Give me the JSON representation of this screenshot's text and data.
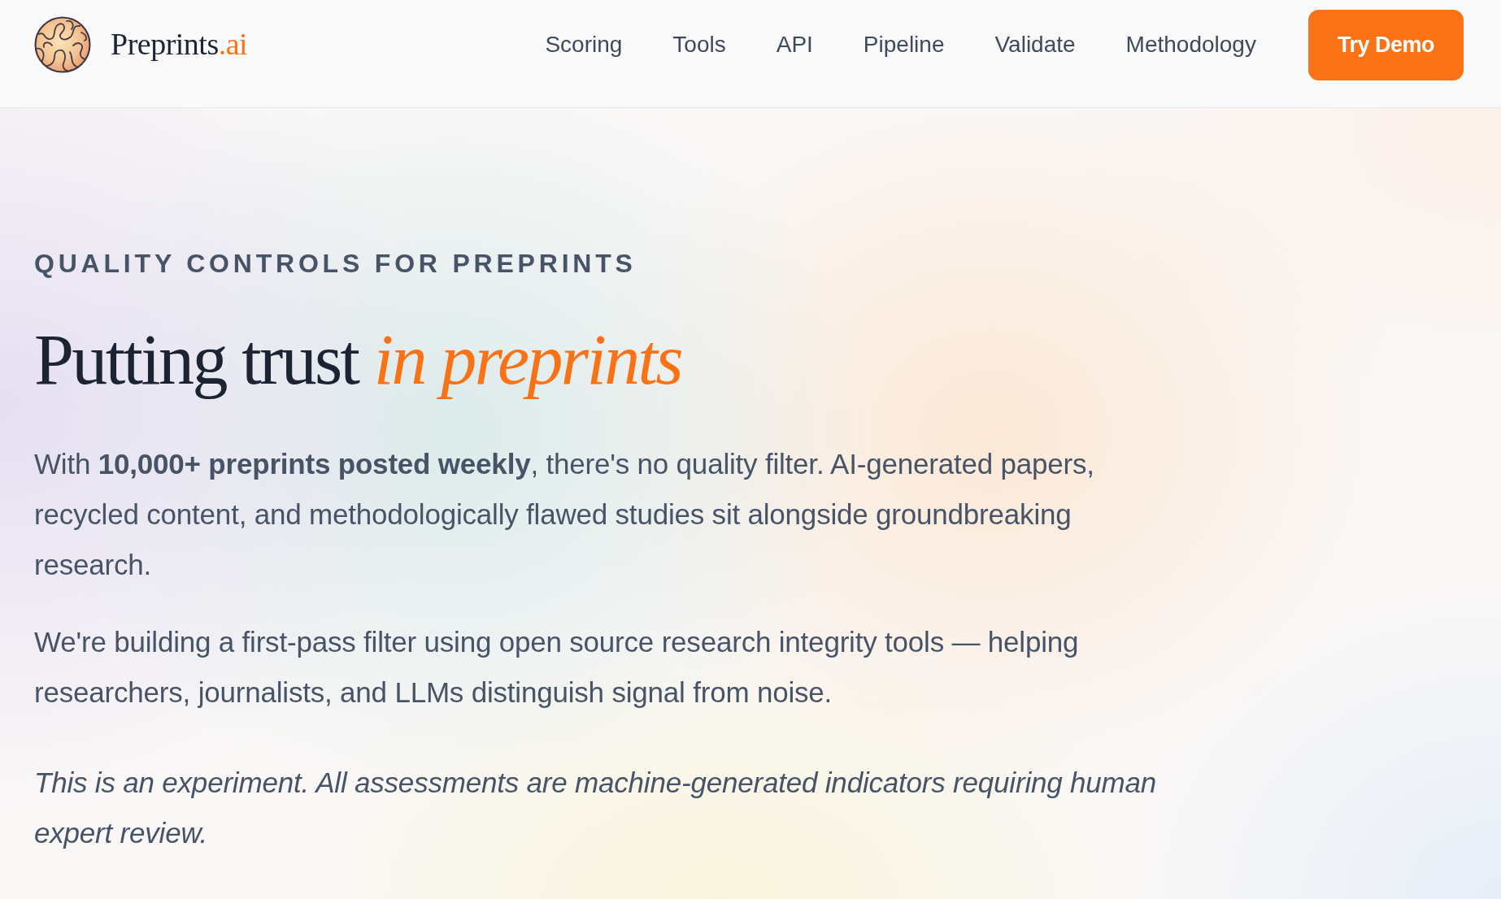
{
  "navbar": {
    "brand": {
      "name": "Preprints",
      "suffix": ".ai"
    },
    "links": [
      "Scoring",
      "Tools",
      "API",
      "Pipeline",
      "Validate",
      "Methodology"
    ],
    "cta": "Try Demo"
  },
  "hero": {
    "eyebrow": "QUALITY CONTROLS FOR PREPRINTS",
    "title": "Putting trust *in preprints*",
    "paragraphs": [
      {
        "kind": "body",
        "text": "With **10,000+ preprints posted weekly**, there's no quality filter. AI-generated papers, recycled content, and methodologically flawed studies sit alongside groundbreaking research."
      },
      {
        "kind": "body",
        "text": "We're building a first-pass filter using open source research integrity tools — helping researchers, journalists, and LLMs distinguish signal from noise."
      },
      {
        "kind": "note",
        "text": "This is an experiment. All assessments are machine-generated indicators requiring human expert review."
      }
    ]
  }
}
